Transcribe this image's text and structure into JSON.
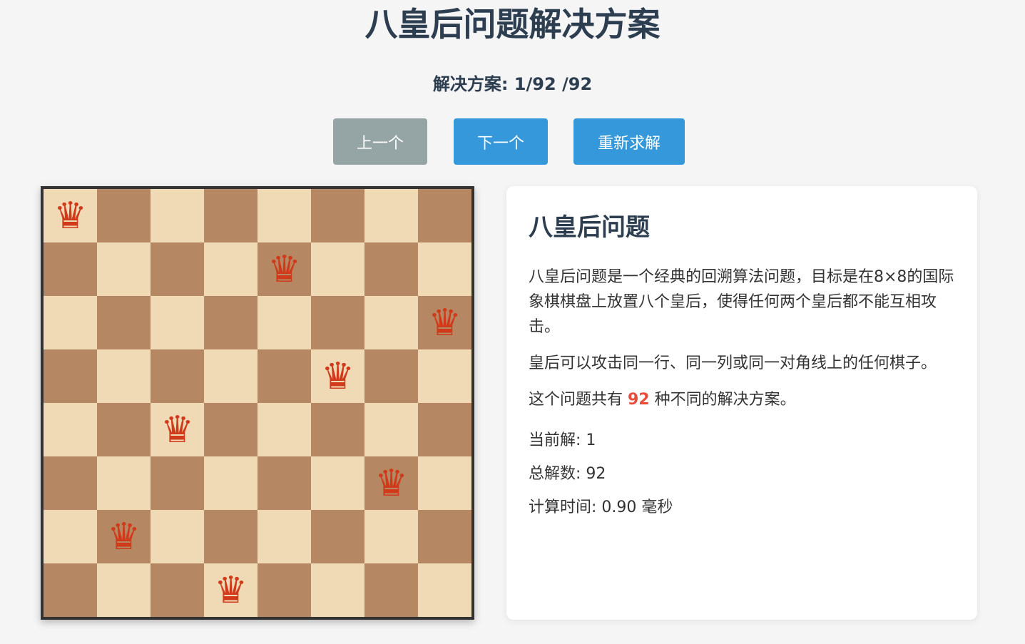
{
  "header": {
    "title": "八皇后问题解决方案",
    "solution_label": "解决方案: ",
    "current_solution": "1",
    "total_suffix": "/92 /92"
  },
  "buttons": {
    "prev_label": "上一个",
    "next_label": "下一个",
    "resolve_label": "重新求解"
  },
  "board": {
    "size": 8,
    "queen_glyph": "♛",
    "queen_columns_by_row": [
      0,
      4,
      7,
      5,
      2,
      6,
      1,
      3
    ],
    "colors": {
      "light": "#f0d9b5",
      "dark": "#b58863",
      "queen": "#d03a1a"
    }
  },
  "info": {
    "heading": "八皇后问题",
    "paragraph1": "八皇后问题是一个经典的回溯算法问题，目标是在8×8的国际象棋棋盘上放置八个皇后，使得任何两个皇后都不能互相攻击。",
    "paragraph2": "皇后可以攻击同一行、同一列或同一对角线上的任何棋子。",
    "paragraph3_prefix": "这个问题共有 ",
    "paragraph3_count": "92",
    "paragraph3_suffix": " 种不同的解决方案。",
    "current_label": "当前解: 1",
    "total_label": "总解数: 92",
    "time_label": "计算时间: 0.90 毫秒"
  },
  "colors": {
    "primary": "#3498db",
    "disabled": "#95a5a6",
    "highlight": "#e74c3c",
    "text": "#2c3e50"
  }
}
